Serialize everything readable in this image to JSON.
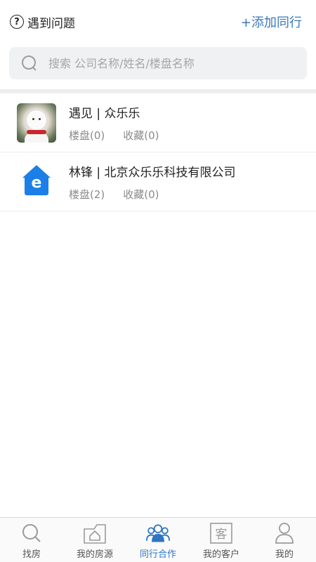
{
  "header": {
    "help_icon": "?",
    "help_label": "遇到问题",
    "add_button": "+添加同行"
  },
  "search": {
    "placeholder": "搜索 公司名称/姓名/楼盘名称",
    "value": ""
  },
  "list": [
    {
      "avatar": "snowman-photo",
      "name": "遇见 | 众乐乐",
      "listings": "楼盘(0)",
      "favorites": "收藏(0)"
    },
    {
      "avatar": "blue-house-logo",
      "logo_glyph": "e",
      "name": "林锋 | 北京众乐乐科技有限公司",
      "listings": "楼盘(2)",
      "favorites": "收藏(0)"
    }
  ],
  "tabbar": {
    "active_color": "#2e75c3",
    "inactive_color": "#9a9a9a",
    "tabs": [
      {
        "label": "找房",
        "icon": "search-icon"
      },
      {
        "label": "我的房源",
        "icon": "house-icon"
      },
      {
        "label": "同行合作",
        "icon": "people-icon",
        "active": true
      },
      {
        "label": "我的客户",
        "icon": "customer-icon",
        "icon_text": "客"
      },
      {
        "label": "我的",
        "icon": "person-icon"
      }
    ]
  }
}
